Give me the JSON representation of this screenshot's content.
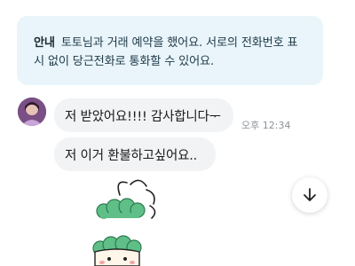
{
  "notice": {
    "label": "안내",
    "line1": "토토님과 거래 예약을 했어요. 서로의 전화번호 표",
    "line2": "시 없이 당근전화로 통화할 수 있어요."
  },
  "messages": [
    {
      "text": "저 받았어요!!!! 감사합니다ᅮ"
    },
    {
      "text": "저 이거 환불하고싶어요.."
    }
  ],
  "timestamp": "오후 12:34",
  "icons": {
    "avatar": "user-avatar",
    "scroll_down": "arrow-down-icon",
    "sticker": "flower-character-sticker"
  },
  "colors": {
    "notice_bg": "#e9f5fb",
    "bubble_bg": "#f2f3f5",
    "sticker_green": "#5fbf86"
  }
}
